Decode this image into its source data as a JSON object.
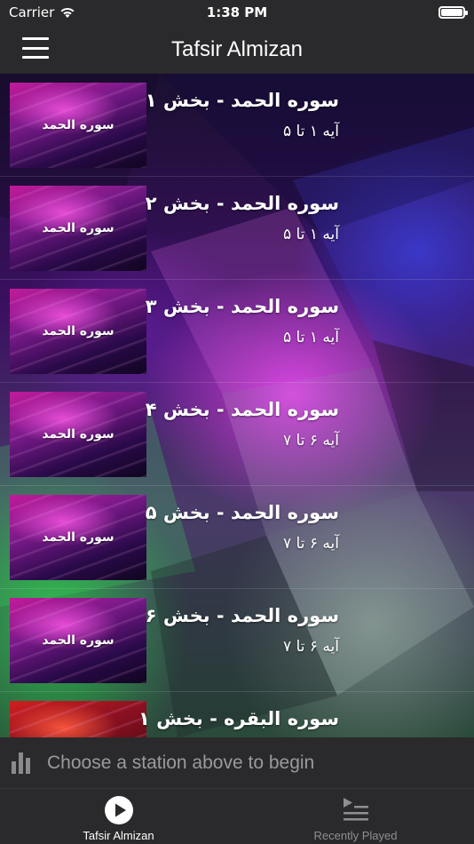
{
  "status_bar": {
    "carrier": "Carrier",
    "time": "1:38 PM"
  },
  "nav": {
    "title": "Tafsir Almizan"
  },
  "tracks": [
    {
      "thumb_label": "سوره الحمد",
      "title": "سوره الحمد - بخش ۱",
      "subtitle": "آیه ۱ تا ۵",
      "thumb_color": "#c21a9a"
    },
    {
      "thumb_label": "سوره الحمد",
      "title": "سوره الحمد - بخش ۲",
      "subtitle": "آیه ۱ تا ۵",
      "thumb_color": "#c21a9a"
    },
    {
      "thumb_label": "سوره الحمد",
      "title": "سوره الحمد - بخش ۳",
      "subtitle": "آیه ۱ تا ۵",
      "thumb_color": "#c21a9a"
    },
    {
      "thumb_label": "سوره الحمد",
      "title": "سوره الحمد - بخش ۴",
      "subtitle": "آیه ۶ تا ۷",
      "thumb_color": "#c21a9a"
    },
    {
      "thumb_label": "سوره الحمد",
      "title": "سوره الحمد - بخش ۵",
      "subtitle": "آیه ۶ تا ۷",
      "thumb_color": "#c21a9a"
    },
    {
      "thumb_label": "سوره الحمد",
      "title": "سوره الحمد - بخش ۶",
      "subtitle": "آیه ۶ تا ۷",
      "thumb_color": "#c21a9a"
    },
    {
      "thumb_label": "",
      "title": "سوره البقره - بخش ۱",
      "subtitle": "",
      "thumb_color": "#d02020"
    }
  ],
  "now_playing": {
    "text": "Choose a station above to begin",
    "icon": "equalizer-icon"
  },
  "tabs": [
    {
      "label": "Tafsir Almizan",
      "icon": "play-circle-icon",
      "active": true
    },
    {
      "label": "Recently Played",
      "icon": "playlist-icon",
      "active": false
    }
  ],
  "colors": {
    "bar_background": "#2a2a2c",
    "inactive_tab": "#8e8e93",
    "thumb_magenta": "#c21a9a",
    "thumb_red": "#d02020"
  }
}
